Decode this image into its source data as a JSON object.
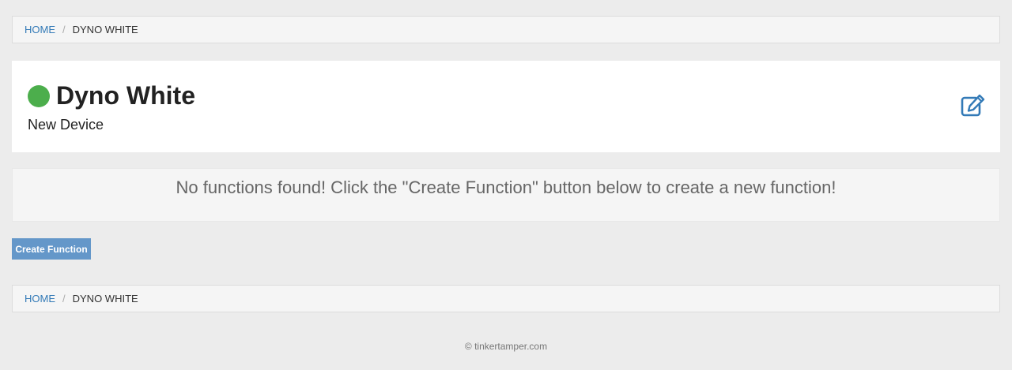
{
  "breadcrumb": {
    "home": "HOME",
    "separator": "/",
    "current": "DYNO WHITE"
  },
  "device": {
    "name": "Dyno White",
    "description": "New Device",
    "status_color": "#4cae4c",
    "edit_icon": "edit-icon"
  },
  "functions": {
    "empty_message": "No functions found! Click the \"Create Function\" button below to create a new function!",
    "create_button": "Create Function"
  },
  "footer": {
    "copyright": "© tinkertamper.com"
  },
  "colors": {
    "accent": "#337ab7",
    "button": "#6497c9",
    "status_online": "#4cae4c"
  }
}
